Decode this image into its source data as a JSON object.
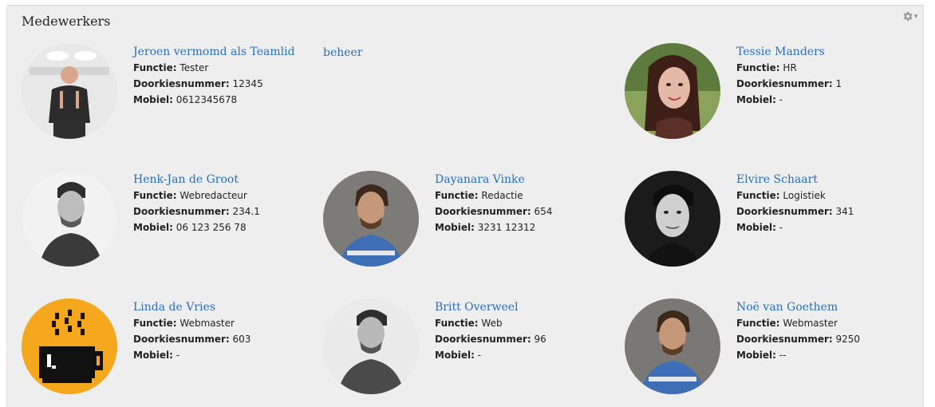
{
  "panel": {
    "title": "Medewerkers",
    "settings_icon": "gear-icon"
  },
  "extra_link": "beheer",
  "labels": {
    "functie": "Functie:",
    "doorkies": "Doorkiesnummer:",
    "mobiel": "Mobiel:"
  },
  "employees": [
    {
      "name": "Jeroen vermomd als Teamlid",
      "functie": "Tester",
      "doorkies": "12345",
      "mobiel": "0612345678"
    },
    {
      "name": "Tessie Manders",
      "functie": "HR",
      "doorkies": "1",
      "mobiel": "-"
    },
    {
      "name": "Henk-Jan de Groot",
      "functie": "Webredacteur",
      "doorkies": "234.1",
      "mobiel": "06 123 256 78"
    },
    {
      "name": "Dayanara Vinke",
      "functie": "Redactie",
      "doorkies": "654",
      "mobiel": "3231 12312"
    },
    {
      "name": "Elvire Schaart",
      "functie": "Logistiek",
      "doorkies": "341",
      "mobiel": "-"
    },
    {
      "name": "Linda de Vries",
      "functie": "Webmaster",
      "doorkies": "603",
      "mobiel": "-"
    },
    {
      "name": "Britt Overweel",
      "functie": "Web",
      "doorkies": "96",
      "mobiel": "-"
    },
    {
      "name": "Noë van Goethem",
      "functie": "Webmaster",
      "doorkies": "9250",
      "mobiel": "--"
    }
  ]
}
